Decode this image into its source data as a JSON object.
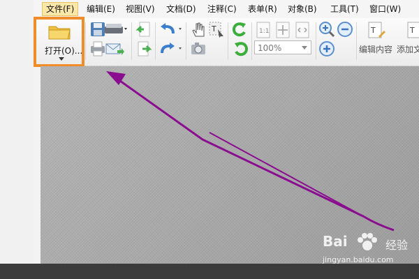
{
  "menu": {
    "items": [
      {
        "label": "文件(F)",
        "active": true
      },
      {
        "label": "编辑(E)"
      },
      {
        "label": "视图(V)"
      },
      {
        "label": "文档(D)"
      },
      {
        "label": "注释(C)"
      },
      {
        "label": "表单(R)"
      },
      {
        "label": "对象(B)"
      },
      {
        "label": "工具(T)"
      },
      {
        "label": "窗口(W)"
      }
    ]
  },
  "toolbar": {
    "open_label": "打开(O)...",
    "zoom_value": "100%",
    "edit_content_label": "编辑内容",
    "add_text_label": "添加文"
  },
  "watermark": {
    "brand": "Bai",
    "name": "经验",
    "url": "jingyan.baidu.com"
  },
  "colors": {
    "highlight": "#f08d2a",
    "annotation_arrow": "#8a0d8f",
    "menu_active": "#fbe7a8"
  }
}
